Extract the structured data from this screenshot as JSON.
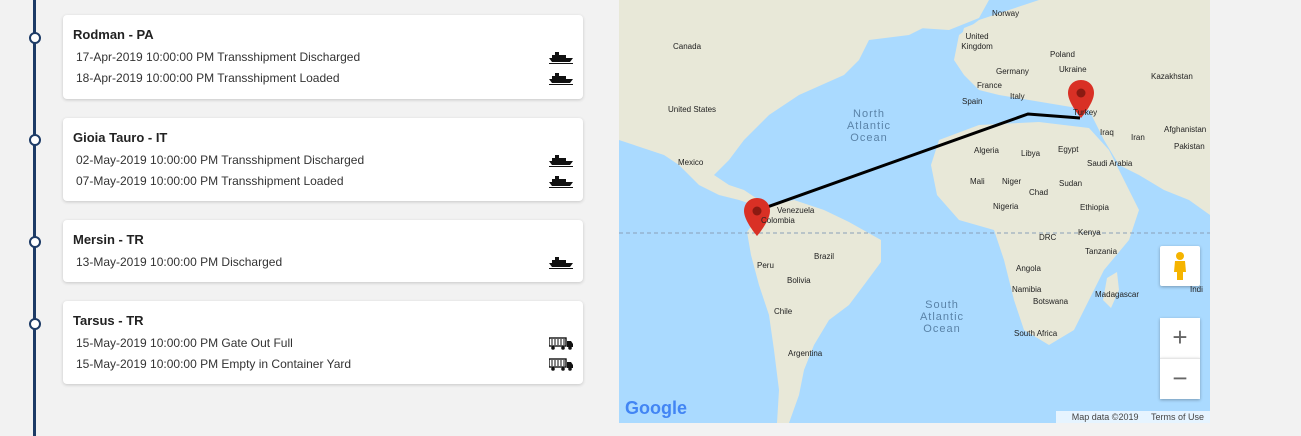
{
  "stops": [
    {
      "title": "Rodman - PA",
      "events": [
        {
          "text": "17-Apr-2019 10:00:00 PM Transshipment Discharged",
          "icon": "ship-icon"
        },
        {
          "text": "18-Apr-2019 10:00:00 PM Transshipment Loaded",
          "icon": "ship-icon"
        }
      ]
    },
    {
      "title": "Gioia Tauro - IT",
      "events": [
        {
          "text": "02-May-2019 10:00:00 PM Transshipment Discharged",
          "icon": "ship-icon"
        },
        {
          "text": "07-May-2019 10:00:00 PM Transshipment Loaded",
          "icon": "ship-icon"
        }
      ]
    },
    {
      "title": "Mersin - TR",
      "events": [
        {
          "text": "13-May-2019 10:00:00 PM Discharged",
          "icon": "ship-icon"
        }
      ]
    },
    {
      "title": "Tarsus - TR",
      "events": [
        {
          "text": "15-May-2019 10:00:00 PM Gate Out Full",
          "icon": "truck-icon"
        },
        {
          "text": "15-May-2019 10:00:00 PM Empty in Container Yard",
          "icon": "truck-icon"
        }
      ]
    }
  ],
  "map": {
    "country_labels": [
      "Norway",
      "Canada",
      "United Kingdom",
      "Poland",
      "Germany",
      "Ukraine",
      "Kazakhstan",
      "France",
      "Spain",
      "Italy",
      "Turkey",
      "United States",
      "Algeria",
      "Libya",
      "Egypt",
      "Iraq",
      "Iran",
      "Afghanistan",
      "Pakistan",
      "Mexico",
      "Saudi Arabia",
      "Mali",
      "Niger",
      "Chad",
      "Sudan",
      "Venezuela",
      "Colombia",
      "Nigeria",
      "Ethiopia",
      "DRC",
      "Kenya",
      "Peru",
      "Brazil",
      "Tanzania",
      "Bolivia",
      "Angola",
      "Chile",
      "Namibia",
      "Botswana",
      "Madagascar",
      "Argentina",
      "South Africa",
      "Indi"
    ],
    "ocean_labels": [
      [
        "North",
        "Atlantic",
        "Ocean"
      ],
      [
        "South",
        "Atlantic",
        "Ocean"
      ]
    ],
    "attribution": "Map data ©2019",
    "terms": "Terms of Use",
    "logo": "Google",
    "zoom_in": "+",
    "zoom_out": "−",
    "colors": {
      "water": "#aadaff",
      "land": "#e8e8d8",
      "route": "#000000",
      "marker": "#d93025"
    }
  }
}
